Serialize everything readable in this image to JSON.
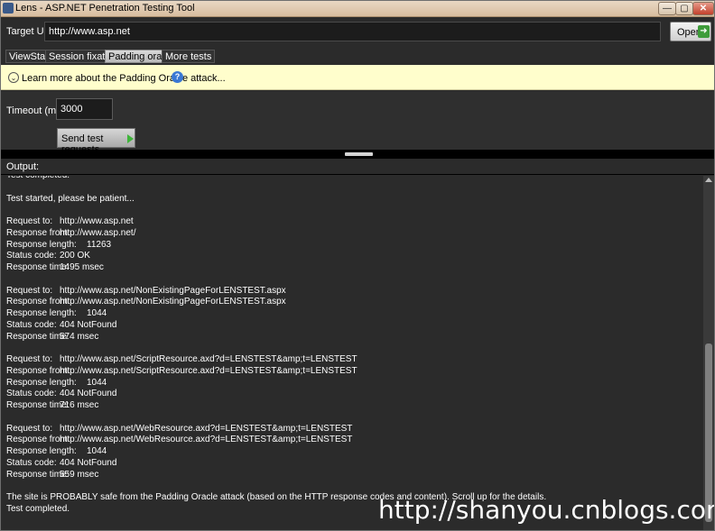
{
  "window": {
    "title": "Lens - ASP.NET Penetration Testing Tool"
  },
  "window_controls": {
    "minimize": "—",
    "maximize": "▢",
    "close": "✕"
  },
  "target": {
    "label": "Target URL:",
    "value": "http://www.asp.net",
    "open_label": "Open"
  },
  "tabs": [
    {
      "label": "ViewState",
      "active": false
    },
    {
      "label": "Session fixation",
      "active": false
    },
    {
      "label": "Padding oracle",
      "active": true
    },
    {
      "label": "More tests",
      "active": false
    }
  ],
  "infobar": {
    "text": "Learn more about the Padding Oracle attack...",
    "help": "?"
  },
  "settings": {
    "timeout_label": "Timeout (ms):",
    "timeout_value": "3000",
    "send_label": "Send test requests"
  },
  "output": {
    "label": "Output:",
    "lines": [
      {
        "k": "Test completed."
      },
      {
        "k": ""
      },
      {
        "k": "Test started, please be patient..."
      },
      {
        "k": ""
      },
      {
        "k": "Request to:",
        "v": "http://www.asp.net",
        "indent": "a"
      },
      {
        "k": "Response from:",
        "v": "http://www.asp.net/",
        "indent": "b"
      },
      {
        "k": "Response length:",
        "v": "11263",
        "indent": "c"
      },
      {
        "k": "Status code:",
        "v": "200 OK",
        "indent": "d"
      },
      {
        "k": "Response time:",
        "v": "1495 msec",
        "indent": "e"
      },
      {
        "k": ""
      },
      {
        "k": "Request to:",
        "v": "http://www.asp.net/NonExistingPageForLENSTEST.aspx",
        "indent": "a"
      },
      {
        "k": "Response from:",
        "v": "http://www.asp.net/NonExistingPageForLENSTEST.aspx",
        "indent": "a"
      },
      {
        "k": "Response length:",
        "v": "1044",
        "indent": "c"
      },
      {
        "k": "Status code:",
        "v": "404 NotFound",
        "indent": "d"
      },
      {
        "k": "Response time:",
        "v": "574 msec",
        "indent": "d"
      },
      {
        "k": ""
      },
      {
        "k": "Request to:",
        "v": "http://www.asp.net/ScriptResource.axd?d=LENSTEST&amp;t=LENSTEST",
        "indent": "a"
      },
      {
        "k": "Response from:",
        "v": "http://www.asp.net/ScriptResource.axd?d=LENSTEST&amp;t=LENSTEST",
        "indent": "a"
      },
      {
        "k": "Response length:",
        "v": "1044",
        "indent": "c"
      },
      {
        "k": "Status code:",
        "v": "404 NotFound",
        "indent": "d"
      },
      {
        "k": "Response time:",
        "v": "716 msec",
        "indent": "d"
      },
      {
        "k": ""
      },
      {
        "k": "Request to:",
        "v": "http://www.asp.net/WebResource.axd?d=LENSTEST&amp;t=LENSTEST",
        "indent": "a"
      },
      {
        "k": "Response from:",
        "v": "http://www.asp.net/WebResource.axd?d=LENSTEST&amp;t=LENSTEST",
        "indent": "a"
      },
      {
        "k": "Response length:",
        "v": "1044",
        "indent": "c"
      },
      {
        "k": "Status code:",
        "v": "404 NotFound",
        "indent": "d"
      },
      {
        "k": "Response time:",
        "v": "559 msec",
        "indent": "d"
      },
      {
        "k": ""
      },
      {
        "k": "The site is PROBABLY safe from the Padding Oracle attack (based on the HTTP response codes and content). Scroll up for the details."
      },
      {
        "k": "Test completed."
      }
    ]
  },
  "watermark": "http://shanyou.cnblogs.com"
}
